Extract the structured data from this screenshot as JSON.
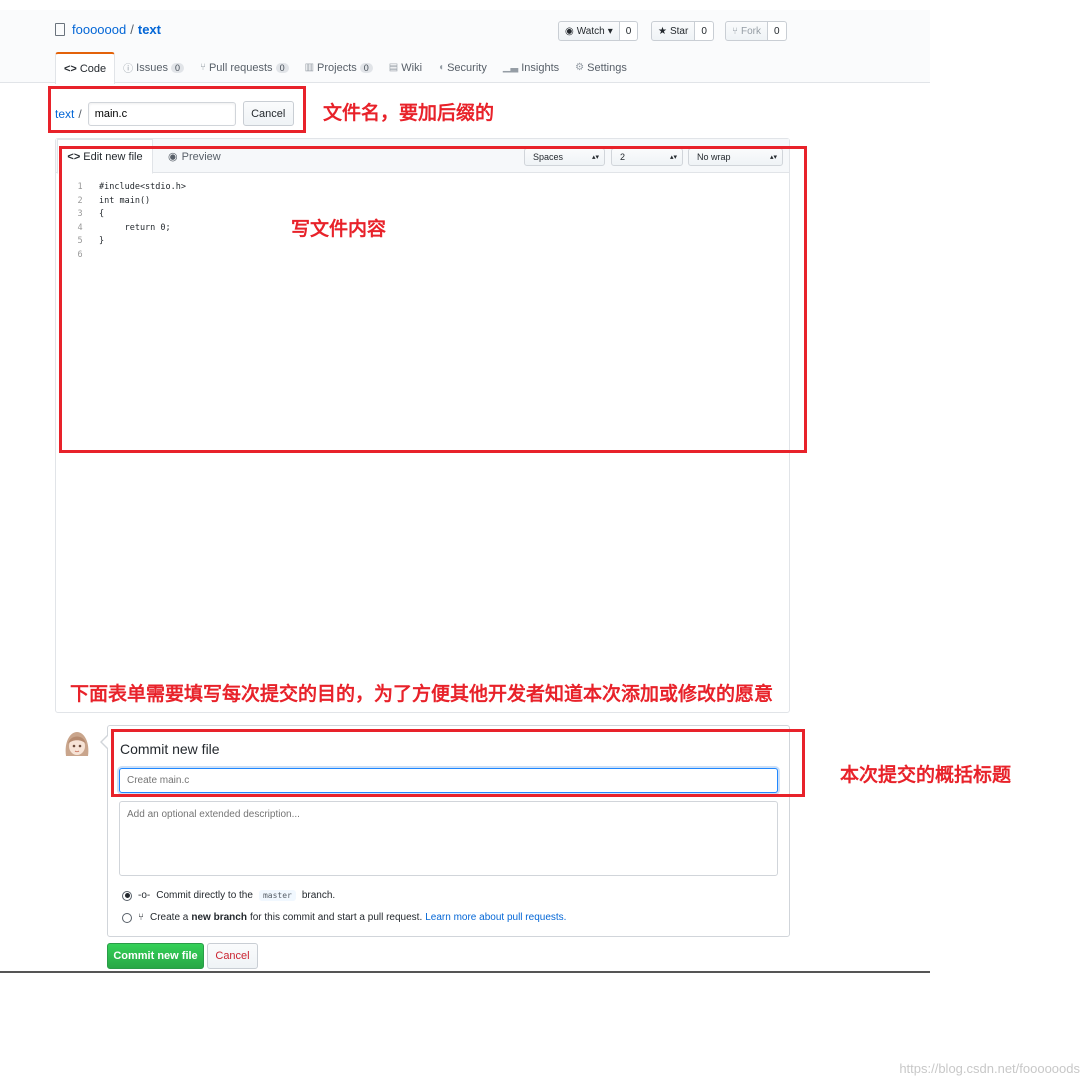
{
  "repo": {
    "owner": "fooooood",
    "separator": "/",
    "name": "text"
  },
  "actions": [
    {
      "label": "Watch",
      "count": "0",
      "icon": "eye-icon",
      "caret": "▾"
    },
    {
      "label": "Star",
      "count": "0",
      "icon": "star-icon"
    },
    {
      "label": "Fork",
      "count": "0",
      "icon": "fork-icon",
      "disabled": true
    }
  ],
  "tabs": [
    {
      "label": "Code",
      "icon": "code-icon",
      "active": true
    },
    {
      "label": "Issues",
      "count": "0",
      "icon": "issue-icon"
    },
    {
      "label": "Pull requests",
      "count": "0",
      "icon": "pull-request-icon"
    },
    {
      "label": "Projects",
      "count": "0",
      "icon": "project-icon"
    },
    {
      "label": "Wiki",
      "icon": "book-icon"
    },
    {
      "label": "Security",
      "icon": "shield-icon"
    },
    {
      "label": "Insights",
      "icon": "graph-icon"
    },
    {
      "label": "Settings",
      "icon": "gear-icon"
    }
  ],
  "filename": {
    "crumb": "text",
    "sep": "/",
    "value": "main.c",
    "cancel": "Cancel"
  },
  "editor": {
    "tab_edit": "Edit new file",
    "tab_preview": "Preview",
    "indent_mode": "Spaces",
    "indent_size": "2",
    "wrap_mode": "No wrap",
    "lines": [
      {
        "n": "1",
        "text": "#include<stdio.h>"
      },
      {
        "n": "2",
        "text": "int main()"
      },
      {
        "n": "3",
        "text": "{"
      },
      {
        "n": "4",
        "text": "     return 0;"
      },
      {
        "n": "5",
        "text": "}"
      },
      {
        "n": "6",
        "text": ""
      }
    ]
  },
  "commit": {
    "title": "Commit new file",
    "summary_placeholder": "Create main.c",
    "desc_placeholder": "Add an optional extended description...",
    "opt1_pre": "Commit directly to the",
    "branch": "master",
    "opt1_post": "branch.",
    "opt2_pre": "Create a",
    "opt2_bold": "new branch",
    "opt2_post": "for this commit and start a pull request.",
    "opt2_link": "Learn more about pull requests.",
    "submit": "Commit new file",
    "cancel": "Cancel"
  },
  "annotations": {
    "filename": "文件名，要加后缀的",
    "content": "写文件内容",
    "form": "下面表单需要填写每次提交的目的，为了方便其他开发者知道本次添加或修改的愿意",
    "summary": "本次提交的概括标题",
    "color": "#e8222a"
  },
  "watermark": "https://blog.csdn.net/foooooods"
}
